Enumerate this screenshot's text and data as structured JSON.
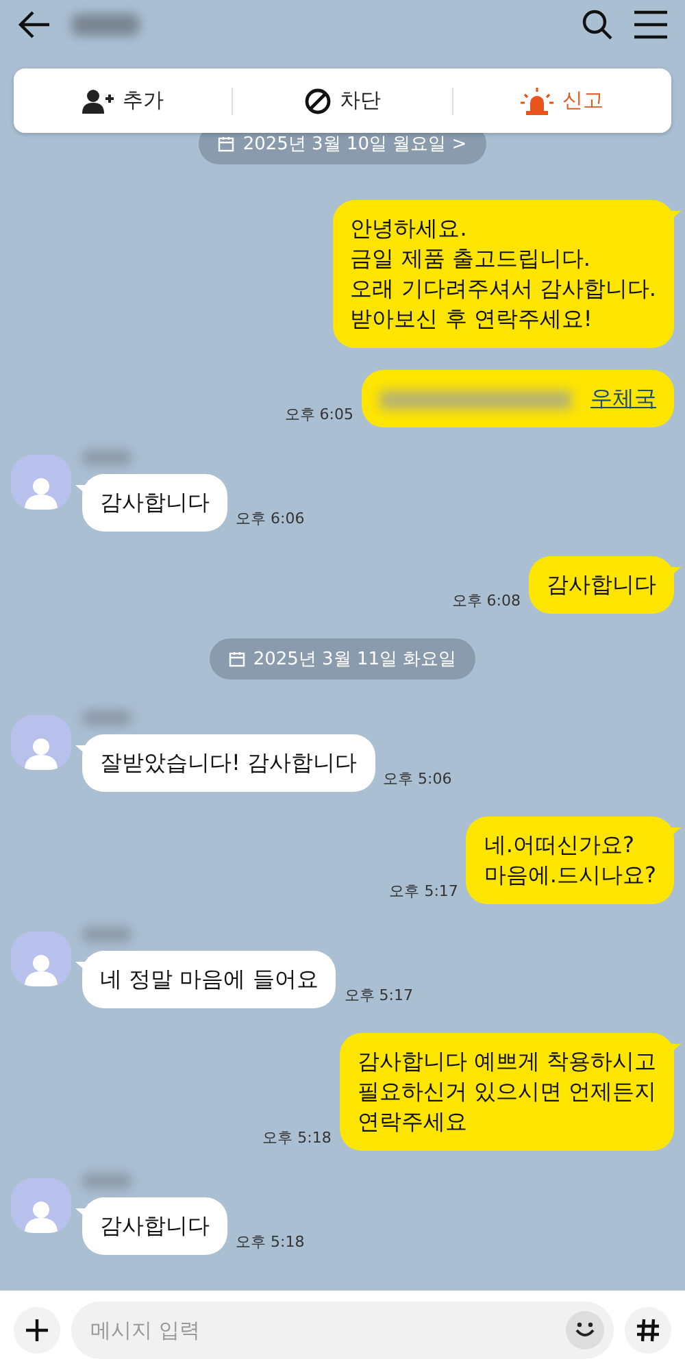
{
  "header": {
    "title_redacted": true
  },
  "actions": [
    {
      "kind": "add",
      "label": "추가"
    },
    {
      "kind": "block",
      "label": "차단"
    },
    {
      "kind": "report",
      "label": "신고"
    }
  ],
  "messages": [
    {
      "kind": "date",
      "text": "2025년 3월 10일 월요일 >"
    },
    {
      "kind": "sent",
      "lines": [
        "안녕하세요.",
        "금일 제품 출고드립니다.",
        "오래 기다려주셔서 감사합니다.",
        "받아보신 후 연락주세요!"
      ]
    },
    {
      "kind": "sent",
      "redacted": true,
      "link": "우체국",
      "time": "오후 6:05"
    },
    {
      "kind": "received",
      "lines": [
        "감사합니다"
      ],
      "time": "오후 6:06"
    },
    {
      "kind": "sent",
      "lines": [
        "감사합니다"
      ],
      "time": "오후 6:08"
    },
    {
      "kind": "date",
      "text": "2025년 3월 11일 화요일"
    },
    {
      "kind": "received",
      "lines": [
        "잘받았습니다! 감사합니다"
      ],
      "time": "오후 5:06"
    },
    {
      "kind": "sent",
      "lines": [
        "네.어떠신가요?",
        "마음에.드시나요?"
      ],
      "time": "오후 5:17"
    },
    {
      "kind": "received",
      "lines": [
        "네 정말 마음에 들어요"
      ],
      "time": "오후 5:17"
    },
    {
      "kind": "sent",
      "lines": [
        "감사합니다 예쁘게 착용하시고",
        "필요하신거 있으시면 언제든지",
        "연락주세요"
      ],
      "time": "오후 5:18"
    },
    {
      "kind": "received",
      "lines": [
        "감사합니다"
      ],
      "time": "오후 5:18"
    }
  ],
  "input": {
    "placeholder": "메시지 입력"
  }
}
